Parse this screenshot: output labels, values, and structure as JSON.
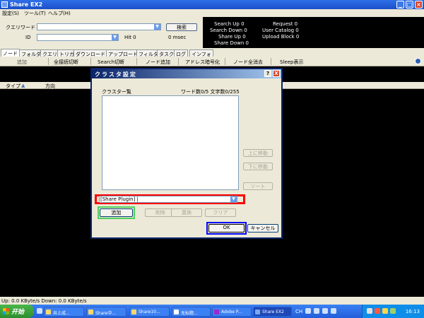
{
  "window": {
    "title": "Share EX2"
  },
  "menu": [
    "設定(S)",
    "ツール(T)",
    "ヘルプ(H)"
  ],
  "search": {
    "keyword_label": "クエリワード",
    "keyword_value": "",
    "id_label": "ID",
    "id_value": "",
    "search_button": "検索",
    "hits_label": "Hit 0",
    "time_label": "0 msec"
  },
  "stats": {
    "search_up": "Search Up 0",
    "search_down": "Search Down 0",
    "share_up": "Share Up 0",
    "share_down": "Share Down 0",
    "request": "Request 0",
    "user_catalog": "User Catalog 0",
    "upload_block": "Upload Block 0"
  },
  "tabs": [
    "ノード",
    "フォルダ",
    "クエリ",
    "トリガ",
    "ダウンロード",
    "アップロード",
    "フィルタ",
    "タスク",
    "ログ",
    "インフォ"
  ],
  "toolbar": [
    "追加",
    "全接続切断",
    "Search切断",
    "ノード追加",
    "アドレス暗号化",
    "ノード全消去",
    "Sleep表示"
  ],
  "list_headers": [
    "タイプ",
    "方向"
  ],
  "list_sort_indicator": "▲",
  "statusbar": {
    "text": "Up: 0.0 KByte/s Down: 0.0 KByte/s"
  },
  "dialog": {
    "title": "クラスタ設定",
    "help": "?",
    "close": "X",
    "list_label": "クラスター覧",
    "count_label": "ワード数0/5 文字数0/255",
    "move_up": "上に移動",
    "move_down": "下に移動",
    "sort": "ソート",
    "combo_value": "[Share Plugin] |",
    "add": "追加",
    "delete": "削除",
    "replace": "置換",
    "clear": "クリア",
    "ok": "OK",
    "cancel": "キャンセル"
  },
  "taskbar": {
    "start": "开始",
    "tasks": [
      "井上成...",
      "Share中...",
      "Share10...",
      "无标题...",
      "Adobe P...",
      "Share EX2"
    ],
    "lang": "CH",
    "clock": "16:13"
  }
}
